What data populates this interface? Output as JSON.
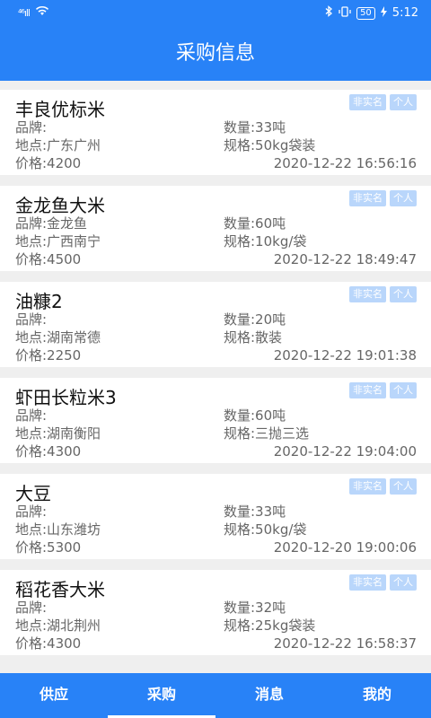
{
  "status": {
    "signal": "⁴⁶ıll",
    "wifi": "wifi",
    "battery": "50",
    "time": "5:12"
  },
  "header": {
    "title": "采购信息"
  },
  "listings": [
    {
      "name": "丰良优标米",
      "badge1": "非实名",
      "badge2": "个人",
      "brand": "品牌:",
      "location": "地点:广东广州",
      "price": "价格:4200",
      "quantity": "数量:33吨",
      "spec": "规格:50kg袋装",
      "datetime": "2020-12-22 16:56:16"
    },
    {
      "name": "金龙鱼大米",
      "badge1": "非实名",
      "badge2": "个人",
      "brand": "品牌:金龙鱼",
      "location": "地点:广西南宁",
      "price": "价格:4500",
      "quantity": "数量:60吨",
      "spec": "规格:10kg/袋",
      "datetime": "2020-12-22 18:49:47"
    },
    {
      "name": "油糠2",
      "badge1": "非实名",
      "badge2": "个人",
      "brand": "品牌:",
      "location": "地点:湖南常德",
      "price": "价格:2250",
      "quantity": "数量:20吨",
      "spec": "规格:散装",
      "datetime": "2020-12-22 19:01:38"
    },
    {
      "name": "虾田长粒米3",
      "badge1": "非实名",
      "badge2": "个人",
      "brand": "品牌:",
      "location": "地点:湖南衡阳",
      "price": "价格:4300",
      "quantity": "数量:60吨",
      "spec": "规格:三抛三选",
      "datetime": "2020-12-22 19:04:00"
    },
    {
      "name": "大豆",
      "badge1": "非实名",
      "badge2": "个人",
      "brand": "品牌:",
      "location": "地点:山东潍坊",
      "price": "价格:5300",
      "quantity": "数量:33吨",
      "spec": "规格:50kg/袋",
      "datetime": "2020-12-20 19:00:06"
    },
    {
      "name": "稻花香大米",
      "badge1": "非实名",
      "badge2": "个人",
      "brand": "品牌:",
      "location": "地点:湖北荆州",
      "price": "价格:4300",
      "quantity": "数量:32吨",
      "spec": "规格:25kg袋装",
      "datetime": "2020-12-22 16:58:37"
    }
  ],
  "tabs": [
    {
      "label": "供应"
    },
    {
      "label": "采购"
    },
    {
      "label": "消息"
    },
    {
      "label": "我的"
    }
  ]
}
